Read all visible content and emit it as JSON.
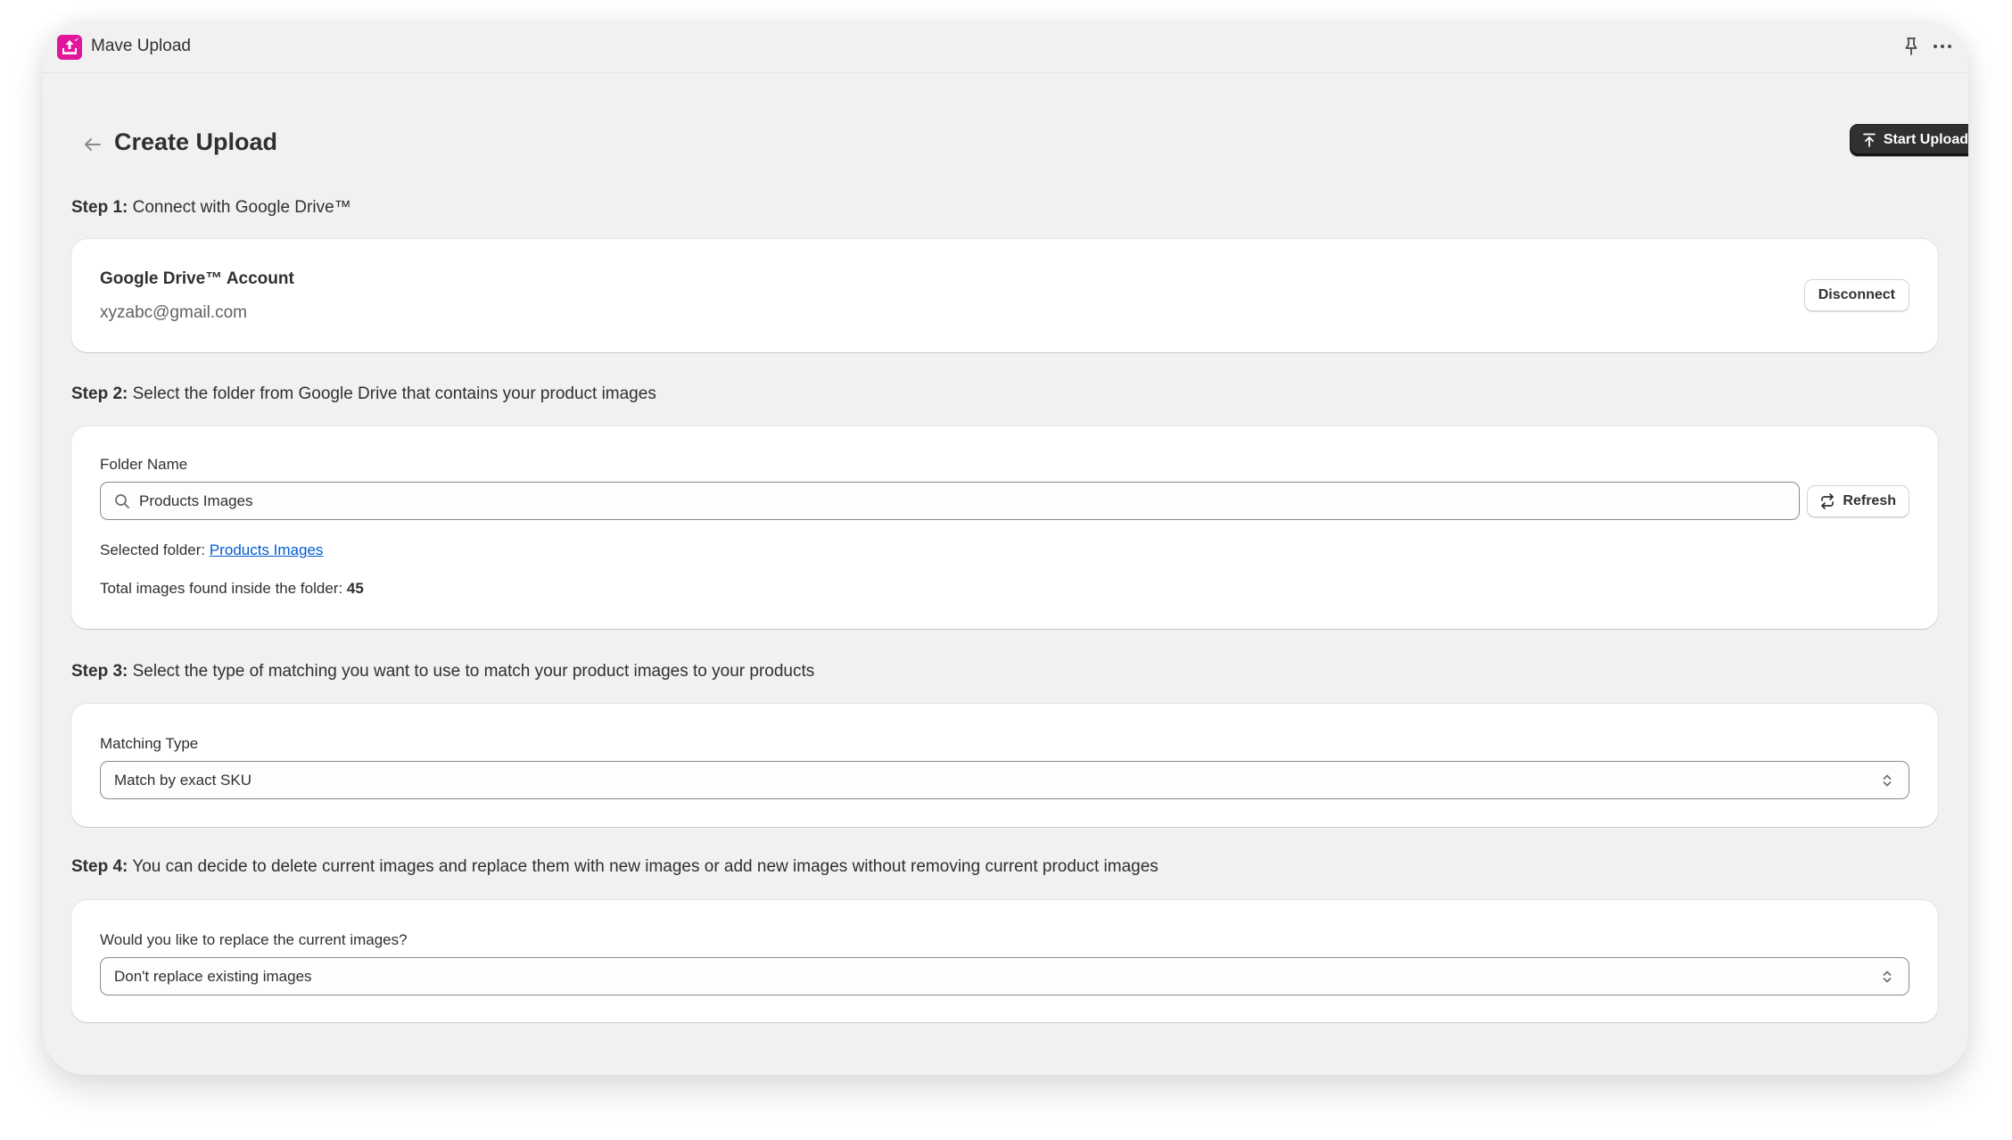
{
  "app": {
    "title": "Mave Upload",
    "logo_icon": "upload-tray-icon",
    "brand_color": "#e0169b",
    "header_icons": [
      "pin-icon",
      "more-horizontal-icon"
    ]
  },
  "page": {
    "title": "Create Upload",
    "back_icon": "arrow-left-icon",
    "primary_action": {
      "label": "Start Upload",
      "icon": "upload-arrow-icon"
    }
  },
  "steps": [
    {
      "prefix": "Step 1:",
      "text": " Connect with Google Drive™",
      "card": {
        "account_title": "Google Drive™ Account",
        "account_email": "xyzabc@gmail.com",
        "disconnect_label": "Disconnect"
      }
    },
    {
      "prefix": "Step 2:",
      "text": " Select the folder from Google Drive that contains your product images",
      "card": {
        "field_label": "Folder Name",
        "input_value": "Products Images",
        "input_icon": "search-icon",
        "refresh_label": "Refresh",
        "refresh_icon": "refresh-icon",
        "selected_folder_label": "Selected folder: ",
        "selected_folder_link": "Products Images",
        "total_images_label": "Total images found inside the folder: ",
        "total_images_count": "45"
      }
    },
    {
      "prefix": "Step 3:",
      "text": " Select the type of matching you want to use to match your product images to your products",
      "card": {
        "field_label": "Matching Type",
        "selected_value": "Match by exact SKU"
      }
    },
    {
      "prefix": "Step 4:",
      "text": " You can decide to delete current images and replace them with new images or add new images without removing current product images",
      "card": {
        "field_label": "Would you like to replace the current images?",
        "selected_value": "Don't replace existing images"
      }
    }
  ]
}
